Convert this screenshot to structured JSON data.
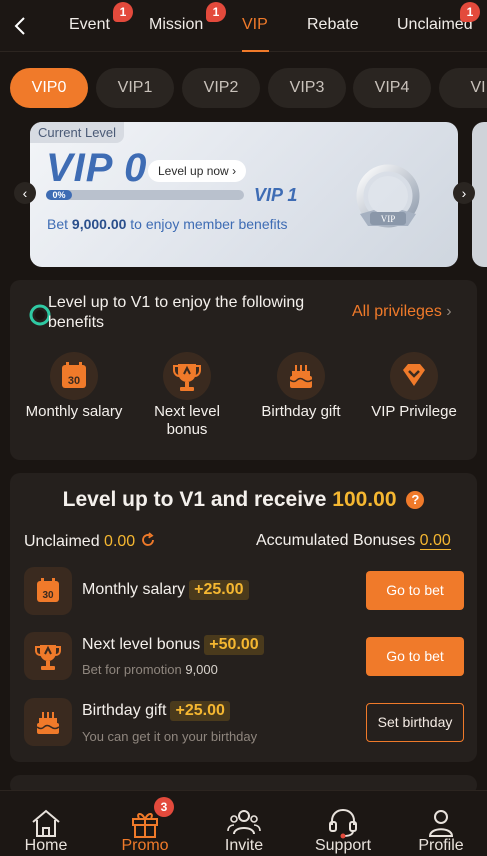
{
  "topnav": {
    "tabs": [
      {
        "label": "Event",
        "badge": "1"
      },
      {
        "label": "Mission",
        "badge": "1"
      },
      {
        "label": "VIP",
        "active": true
      },
      {
        "label": "Rebate"
      },
      {
        "label": "Unclaimed",
        "badge": "1"
      }
    ]
  },
  "vip_levels": [
    "VIP0",
    "VIP1",
    "VIP2",
    "VIP3",
    "VIP4",
    "VI"
  ],
  "card": {
    "current_level_label": "Current Level",
    "level": "VIP 0",
    "level_up_link": "Level up now",
    "progress_percent": "0%",
    "next_level": "VIP 1",
    "bet_prefix": "Bet",
    "bet_amount": "9,000.00",
    "bet_suffix": "to enjoy member benefits",
    "medal_text": "VIP"
  },
  "benefits": {
    "title": "Level up to V1 to enjoy the following benefits",
    "all_privileges": "All privileges",
    "items": [
      {
        "label": "Monthly salary",
        "icon": "calendar-icon",
        "icon_text": "30"
      },
      {
        "label": "Next level bonus",
        "icon": "trophy-icon"
      },
      {
        "label": "Birthday gift",
        "icon": "cake-icon"
      },
      {
        "label": "VIP Privilege",
        "icon": "diamond-icon"
      }
    ]
  },
  "receive": {
    "title_prefix": "Level up to V1 and receive",
    "amount": "100.00",
    "unclaimed_label": "Unclaimed",
    "unclaimed_value": "0.00",
    "accumulated_label": "Accumulated Bonuses",
    "accumulated_value": "0.00",
    "rows": [
      {
        "title": "Monthly salary",
        "bonus": "+25.00",
        "button": "Go to bet",
        "icon": "calendar-icon",
        "icon_text": "30"
      },
      {
        "title": "Next level bonus",
        "bonus": "+50.00",
        "sub_label": "Bet for promotion",
        "sub_value": "9,000",
        "button": "Go to bet",
        "icon": "trophy-icon"
      },
      {
        "title": "Birthday gift",
        "bonus": "+25.00",
        "sub_label": "You can get it on your birthday",
        "button": "Set birthday",
        "icon": "cake-icon"
      }
    ]
  },
  "bottomnav": {
    "items": [
      {
        "label": "Home",
        "icon": "home-icon"
      },
      {
        "label": "Promo",
        "icon": "gift-icon",
        "badge": "3",
        "active": true
      },
      {
        "label": "Invite",
        "icon": "invite-icon"
      },
      {
        "label": "Support",
        "icon": "headset-icon"
      },
      {
        "label": "Profile",
        "icon": "profile-icon"
      }
    ]
  },
  "colors": {
    "accent": "#f07a2a",
    "gold": "#f5b731",
    "background": "#1a1512",
    "panel": "#25201d",
    "badge": "#e34a3c",
    "card_blue": "#3e6cb4"
  }
}
